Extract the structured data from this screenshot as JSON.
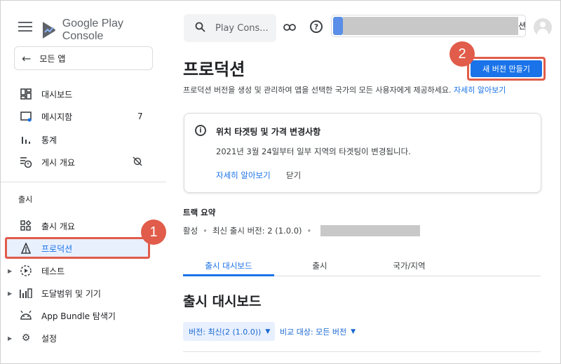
{
  "app": {
    "logo_text": "Google Play Console"
  },
  "sidebar": {
    "all_apps": "모든 앱",
    "items": [
      {
        "label": "대시보드",
        "icon": "dashboard-icon"
      },
      {
        "label": "메시지함",
        "icon": "inbox-icon",
        "count": "7"
      },
      {
        "label": "통계",
        "icon": "bar-chart-icon"
      },
      {
        "label": "게시 개요",
        "icon": "publishing-overview-icon"
      }
    ],
    "release_section": "출시",
    "release_items": [
      {
        "label": "출시 개요",
        "icon": "release-overview-icon"
      },
      {
        "label": "프로덕션",
        "icon": "production-icon"
      },
      {
        "label": "테스트",
        "icon": "testing-icon"
      },
      {
        "label": "도달범위 및 기기",
        "icon": "reach-devices-icon"
      },
      {
        "label": "App Bundle 탐색기",
        "icon": "android-icon"
      },
      {
        "label": "설정",
        "icon": "gear-icon"
      }
    ]
  },
  "topbar": {
    "search_placeholder": "Play Cons...",
    "account_suffix": "션"
  },
  "annotations": {
    "badge1": "1",
    "badge2": "2"
  },
  "main": {
    "title": "프로덕션",
    "subtitle": "프로덕션 버전을 생성 및 관리하여 앱을 선택한 국가의 모든 사용자에게 제공하세요.",
    "subtitle_link": "자세히 알아보기",
    "create_button": "새 버전 만들기",
    "notice": {
      "title": "위치 타겟팅 및 가격 변경사항",
      "body": "2021년 3월 24일부터 일부 지역의 타겟팅이 변경됩니다.",
      "learn_more": "자세히 알아보기",
      "dismiss": "닫기"
    },
    "track_summary": {
      "title": "트랙 요약",
      "status": "활성",
      "latest_release": "최신 출시 버전: 2 (1.0.0)"
    },
    "tabs": [
      "출시 대시보드",
      "출시",
      "국가/지역"
    ],
    "dashboard_title": "출시 대시보드",
    "filter_version": "버전: 최신(2 (1.0.0))",
    "filter_compare": "비교 대상: 모든 버전"
  },
  "colors": {
    "accent": "#1a73e8",
    "annotation": "#e15c4a",
    "active_bg": "#e8f0fe"
  }
}
